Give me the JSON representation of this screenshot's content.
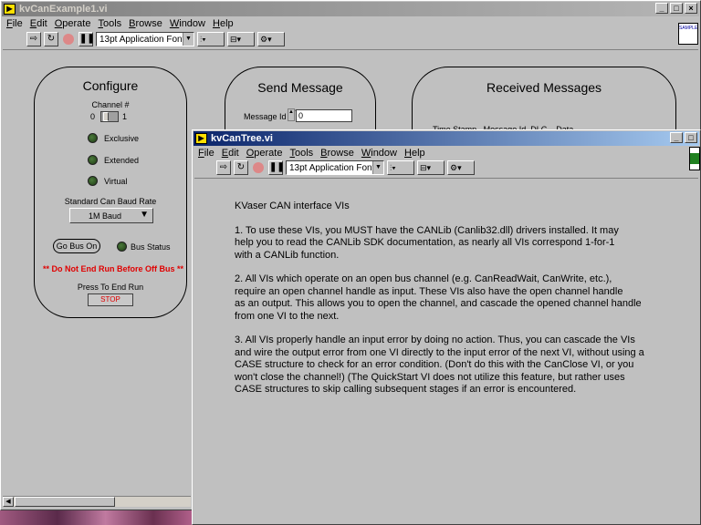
{
  "back_window": {
    "title": "kvCanExample1.vi",
    "menu": [
      "File",
      "Edit",
      "Operate",
      "Tools",
      "Browse",
      "Window",
      "Help"
    ],
    "font": "13pt Application Font",
    "icon_text": "SAMPLE"
  },
  "configure": {
    "title": "Configure",
    "channel_label": "Channel #",
    "channel_0": "0",
    "channel_1": "1",
    "exclusive": "Exclusive",
    "extended": "Extended",
    "virtual": "Virtual",
    "baud_label": "Standard Can Baud Rate",
    "baud_value": "1M Baud",
    "go_bus_on": "Go Bus On",
    "bus_status": "Bus Status",
    "warning": "** Do Not End Run Before Off Bus **",
    "end_run_label": "Press To End Run",
    "stop": "STOP"
  },
  "send": {
    "title": "Send Message",
    "message_id_label": "Message Id",
    "message_id_value": "0"
  },
  "received": {
    "title": "Received Messages",
    "columns": "Time Stamp   Message Id  DLC    Data"
  },
  "front_window": {
    "title": "kvCanTree.vi",
    "menu": [
      "File",
      "Edit",
      "Operate",
      "Tools",
      "Browse",
      "Window",
      "Help"
    ],
    "font": "13pt Application Font"
  },
  "doc": {
    "heading": "KVaser CAN interface VIs",
    "p1": "1.  To use these VIs, you MUST have the CANLib (Canlib32.dll) drivers installed.  It may\nhelp you to read the CANLib SDK documentation, as nearly all VIs correspond 1-for-1\nwith a CANLib function.",
    "p2": "2.  All VIs which operate on an open bus channel (e.g. CanReadWait, CanWrite, etc.),\nrequire an open channel handle as input.  These VIs also have the open channel handle\nas an output.  This allows you to open the channel, and cascade the opened channel handle\nfrom one VI to the next.",
    "p3": "3.  All VIs properly handle an input error by doing no action.  Thus, you can cascade the VIs\nand wire the output error from one VI directly to the input error of the next VI, without using a\nCASE structure to check for an error condition.  (Don't do this with the CanClose VI, or you\nwon't close the channel!)  (The QuickStart VI does not utilize this feature, but rather uses\nCASE structures to skip calling subsequent stages if an error is encountered."
  },
  "colors": {
    "panel": "#c0c0c0",
    "warning_red": "#e00000",
    "active_title": "#0a246a"
  }
}
